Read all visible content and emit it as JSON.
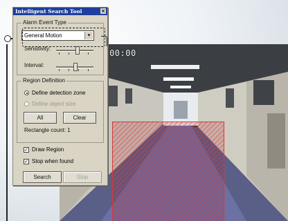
{
  "window": {
    "title": "Intelligent Search Tool",
    "close_glyph": "×"
  },
  "alarm": {
    "group_label": "Alarm Event Type",
    "selected": "General Motion",
    "sensitivity_label": "Sensitivity:",
    "interval_label": "Interval:",
    "sensitivity_level": 0.55,
    "interval_level": 0.5
  },
  "region": {
    "group_label": "Region Definition",
    "option_zone": "Define detection zone",
    "option_object": "Define object size",
    "selected_option": "zone",
    "all_label": "All",
    "clear_label": "Clear",
    "rect_count_label": "Rectangle count: 1"
  },
  "options": {
    "draw_region": "Draw Region",
    "draw_region_checked": true,
    "stop_when_found": "Stop when found",
    "stop_when_found_checked": true
  },
  "actions": {
    "search_label": "Search",
    "stop_label": "Stop"
  },
  "camera": {
    "timestamp": "6 AM09:00:00",
    "zone_color": "#d13a3a"
  },
  "icons": {
    "dropdown_arrow": "▾",
    "checkmark": "✓"
  }
}
